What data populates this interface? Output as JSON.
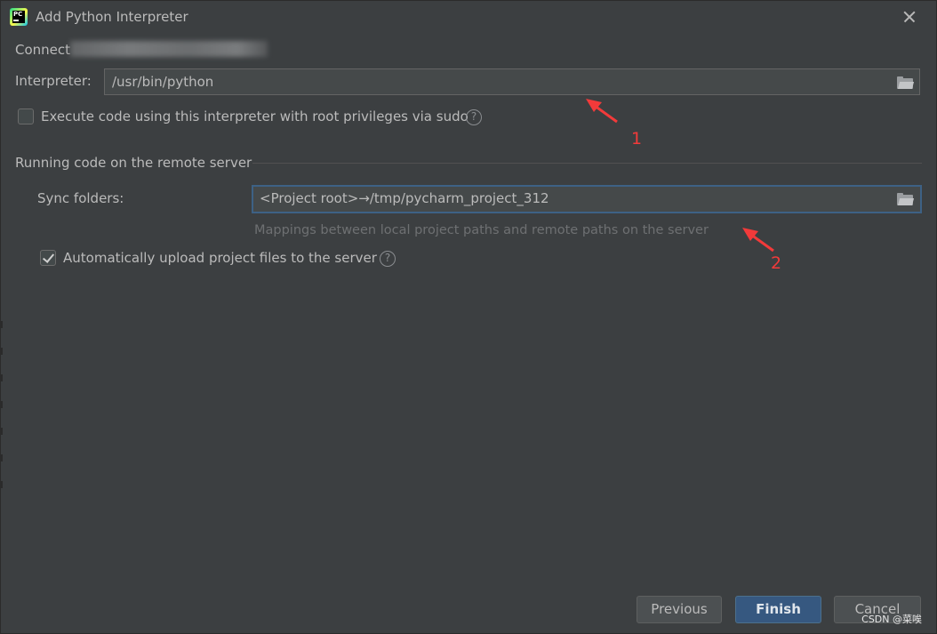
{
  "window": {
    "title": "Add Python Interpreter",
    "app_icon_text": "PC"
  },
  "connection": {
    "label_prefix": "Connect"
  },
  "interpreter": {
    "label": "Interpreter:",
    "value": "/usr/bin/python"
  },
  "sudo_option": {
    "label": "Execute code using this interpreter with root privileges via sudo",
    "checked": false
  },
  "remote_section": {
    "title": "Running code on the remote server",
    "sync_label": "Sync folders:",
    "sync_value": "<Project root>→/tmp/pycharm_project_312",
    "hint": "Mappings between local project paths and remote paths on the server"
  },
  "auto_upload": {
    "label": "Automatically upload project files to the server",
    "checked": true
  },
  "annotations": {
    "first": "1",
    "second": "2",
    "color": "#f23a3a"
  },
  "buttons": {
    "previous": "Previous",
    "finish": "Finish",
    "cancel": "Cancel"
  },
  "help_glyph": "?",
  "watermark": "CSDN @菜唉",
  "colors": {
    "background": "#3c3f41",
    "field_background": "#45494a",
    "focus_border": "#3d6185",
    "primary_button": "#365880",
    "text": "#bbbbbb",
    "hint_text": "#6e7072"
  },
  "icons": {
    "app": "pycharm-icon",
    "close": "close-icon",
    "browse": "folder-icon",
    "help": "help-icon"
  }
}
